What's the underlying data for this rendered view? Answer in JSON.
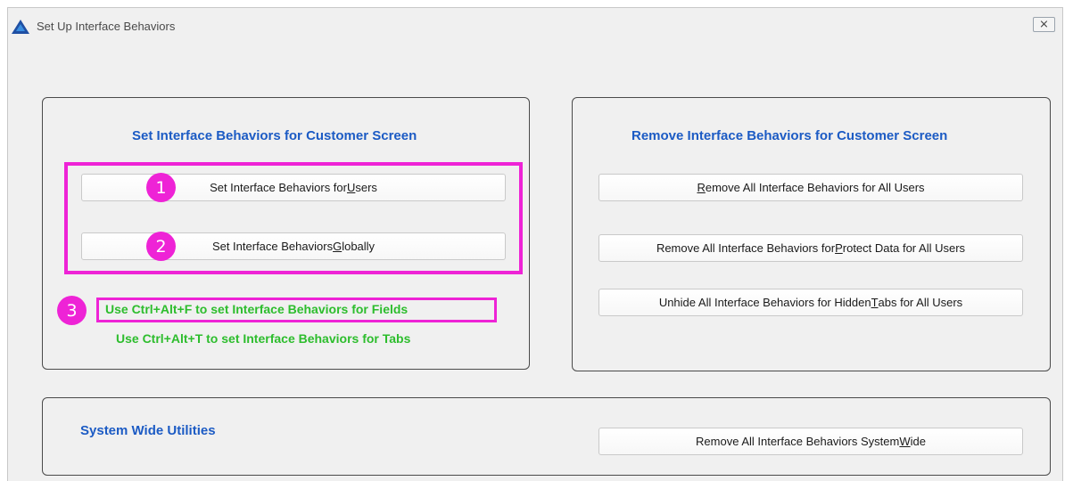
{
  "window": {
    "title": "Set Up Interface Behaviors",
    "close_glyph": "⨯",
    "app_icon": "app-logo-icon"
  },
  "left_group": {
    "title": "Set Interface Behaviors for Customer Screen",
    "buttons": [
      {
        "pre": "Set Interface Behaviors for ",
        "key": "U",
        "post": "sers",
        "badge": "1"
      },
      {
        "pre": "Set Interface Behaviors ",
        "key": "G",
        "post": "lobally",
        "badge": "2"
      }
    ],
    "hints": [
      {
        "text": "Use Ctrl+Alt+F to set Interface Behaviors for Fields",
        "badge": "3"
      },
      {
        "text": "Use Ctrl+Alt+T to set Interface Behaviors for Tabs"
      }
    ]
  },
  "right_group": {
    "title": "Remove Interface Behaviors for Customer Screen",
    "buttons": [
      {
        "pre": "",
        "key": "R",
        "post": "emove All Interface Behaviors for All Users"
      },
      {
        "pre": "Remove All Interface Behaviors for ",
        "key": "P",
        "post": "rotect Data for All Users"
      },
      {
        "pre": "Unhide All Interface Behaviors for Hidden ",
        "key": "T",
        "post": "abs for All Users"
      }
    ]
  },
  "bottom_group": {
    "title": "System Wide Utilities",
    "button": {
      "pre": "Remove All Interface Behaviors System ",
      "key": "W",
      "post": "ide"
    }
  },
  "colors": {
    "heading_blue": "#1c5bc4",
    "hint_green": "#2dbd2d",
    "annotation_magenta": "#ee23d6"
  }
}
